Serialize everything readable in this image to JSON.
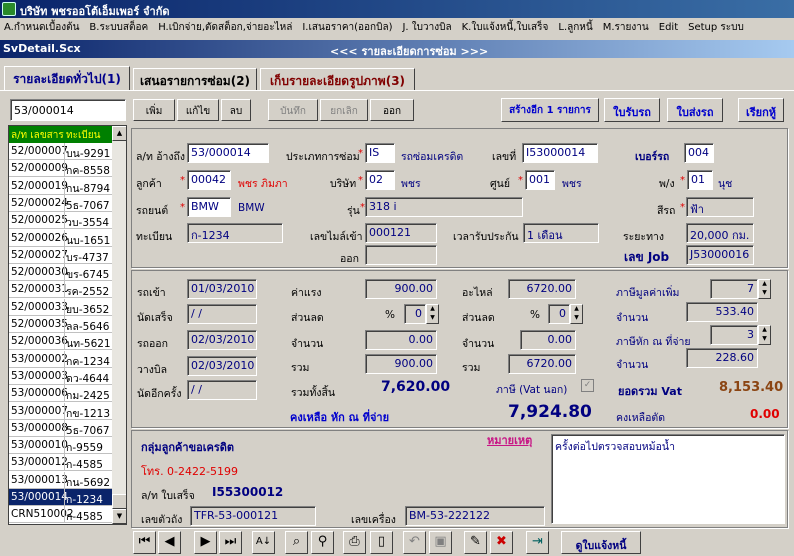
{
  "app": {
    "title": "บริษัท พชรออโต้เอ็มเพอร์  จำกัด"
  },
  "menu": [
    "A.กำหนดเบื้องต้น",
    "B.ระบบสต็อค",
    "H.เบิกจ่าย,ตัดสต็อก,จ่ายอะไหล่",
    "I.เสนอราคา(ออกบิล)",
    "J. ใบวางบิล",
    "K.ใบแจ้งหนี้,ใบเสร็จ",
    "L.ลูกหนี้",
    "M.รายงาน",
    "Edit",
    "Setup ระบบ"
  ],
  "form": {
    "name": "SvDetail.Scx",
    "caption": "<<< รายละเอียดการซ่อม >>>"
  },
  "tabs": [
    "รายละเอียดทั่วไป(1)",
    "เสนอรายการซ่อม(2)",
    "เก็บรายละเอียดรูปภาพ(3)"
  ],
  "search": {
    "value": "53/000014"
  },
  "toolbar": {
    "add": "เพิ่ม",
    "edit": "แก้ไข",
    "del": "ลบ",
    "save": "บันทึก",
    "cancel": "ยกเลิก",
    "exit": "ออก",
    "create_more": "สร้างอีก 1 รายการ",
    "receive": "ใบรับรถ",
    "deliver": "ใบส่งรถ",
    "call": "เรียกหู้"
  },
  "list": {
    "headers": [
      "ล/ท เลขสาร",
      "ทะเบียน"
    ],
    "rows": [
      [
        "52/000007",
        "บน-9291"
      ],
      [
        "52/000009",
        "กค-8558"
      ],
      [
        "52/000019",
        "กน-8794"
      ],
      [
        "52/000024",
        "5ธ-7067"
      ],
      [
        "52/000025",
        "วบ-3554"
      ],
      [
        "52/000026",
        "นบ-1651"
      ],
      [
        "52/000027",
        "บร-4737"
      ],
      [
        "52/000030",
        "ขร-6745"
      ],
      [
        "52/000031",
        "รค-2552"
      ],
      [
        "52/000033",
        "ยบ-3652"
      ],
      [
        "52/000035",
        "ลล-5646"
      ],
      [
        "52/000036",
        "นท-5621"
      ],
      [
        "53/000002",
        "กค-1234"
      ],
      [
        "53/000003",
        "ดว-4644"
      ],
      [
        "53/000006",
        "กม-2425"
      ],
      [
        "53/000007",
        "กข-1213"
      ],
      [
        "53/000008",
        "5ธ-7067"
      ],
      [
        "53/000010",
        "ก-9559"
      ],
      [
        "53/000012",
        "ก-4585"
      ],
      [
        "53/000013",
        "กน-5692"
      ],
      [
        "53/000014",
        "ก-1234"
      ],
      [
        "CRN510002",
        "ก-4585"
      ]
    ],
    "selected_index": 20
  },
  "detail": {
    "ref_label": "ล/ท อ้างถึง",
    "ref": "53/000014",
    "repair_type_label": "ประเภทการซ่อม",
    "repair_type_code": "IS",
    "repair_type_name": "รถซ่อมเครดิต",
    "no_label": "เลขที่",
    "no": "I53000014",
    "car_no_label": "เบอร์รถ",
    "car_no": "004",
    "cust_label": "ลูกค้า",
    "cust_code": "00042",
    "cust_name": "พชร ภิมภา",
    "company_label": "บริษัท",
    "company_code": "02",
    "company_name": "พชร",
    "center_label": "ศูนย์",
    "center_code": "001",
    "center_name": "พชร",
    "pw_label": "พ/ง",
    "pw_code": "01",
    "pw_name": "นุช",
    "brand_label": "รถยนต์",
    "brand_code": "BMW",
    "brand_name": "BMW",
    "model_label": "รุ่น",
    "model": "318 i",
    "color_label": "สีรถ",
    "color": "ฟ้า",
    "plate_label": "ทะเบียน",
    "plate": "ก-1234",
    "mile_label": "เลขไมล์เข้า",
    "mile": "000121",
    "warranty_label": "เวลารับประกัน",
    "warranty": "1 เดือน",
    "distance_label": "ระยะทาง",
    "distance": "20,000 กม.",
    "out_label": "ออก",
    "out": "",
    "job_label": "เลข Job",
    "job": "J53000016"
  },
  "costs": {
    "in_label": "รถเข้า",
    "in_date": "01/03/2010",
    "appt_label": "นัดเสร็จ",
    "appt_date": " / /",
    "outdate_label": "รถออก",
    "outdate": "02/03/2010",
    "bill_label": "วางบิล",
    "bill_date": "02/03/2010",
    "recall_label": "นัดอีกครั้ง",
    "recall_date": " / /",
    "labor_label": "ค่าแรง",
    "labor": "900.00",
    "parts_label": "อะไหล่",
    "parts": "6720.00",
    "vat_label": "ภาษีมูลค่าเพิ่ม",
    "vat_rate": "7",
    "disc_label": "ส่วนลด",
    "pct": "%",
    "disc_pct1": "0",
    "disc_pct2": "0",
    "amount_label": "จำนวน",
    "disc_amt1": "0.00",
    "disc_amt2": "0.00",
    "vat_amt": "533.40",
    "wht_label": "ภาษีหัก ณ ที่จ่าย",
    "wht_rate": "3",
    "sum_label": "รวม",
    "sum1": "900.00",
    "sum2": "6720.00",
    "wht_amt": "228.60",
    "total_label": "รวมทั้งสิ้น",
    "total": "7,620.00",
    "vat_out_label": "ภาษี (Vat นอก)",
    "grand_label": "ยอดรวม Vat",
    "grand": "8,153.40",
    "remain_label": "คงเหลือ หัก ณ ที่จ่าย",
    "remain": "7,924.80",
    "cut_label": "คงเหลือตัด",
    "cut": "0.00"
  },
  "info": {
    "group": "กลุ่มลูกค้าขอเครดิต",
    "phone": "โทร. 0-2422-5199",
    "receipt_label": "ล/ท ใบเสร็จ",
    "receipt": "I55300012",
    "body_label": "เลขตัวถัง",
    "body": "TFR-53-000121",
    "engine_label": "เลขเครื่อง",
    "engine": "BM-53-222122",
    "note_label": "หมายเหตุ",
    "note": "ครั้งต่อไปตรวจสอบหม้อน้ำ"
  },
  "nav": {
    "invoice": "ดูใบแจ้งหนี้"
  },
  "colors": {
    "title_bar": "#0a246a",
    "list_header": "#008000",
    "list_header_text": "#ffff00",
    "accent_red": "#e00000",
    "value_blue": "#000080"
  }
}
